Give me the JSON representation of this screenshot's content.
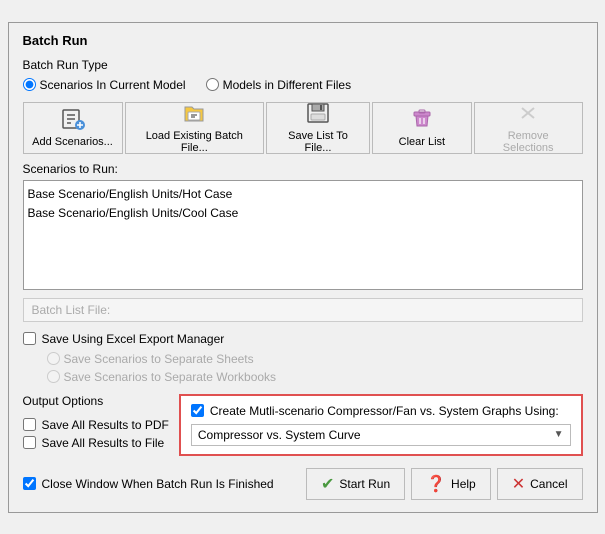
{
  "dialog": {
    "title": "Batch Run",
    "batch_run_type_label": "Batch Run Type",
    "radio_options": [
      {
        "label": "Scenarios In Current Model",
        "value": "scenarios",
        "checked": true
      },
      {
        "label": "Models in Different Files",
        "value": "models",
        "checked": false
      }
    ],
    "toolbar": {
      "buttons": [
        {
          "label": "Add Scenarios...",
          "icon": "📋",
          "disabled": false,
          "name": "add-scenarios-button"
        },
        {
          "label": "Load Existing Batch File...",
          "icon": "📂",
          "disabled": false,
          "name": "load-batch-button"
        },
        {
          "label": "Save List To File...",
          "icon": "💾",
          "disabled": false,
          "name": "save-list-button"
        },
        {
          "label": "Clear List",
          "icon": "🗑",
          "disabled": false,
          "name": "clear-list-button"
        },
        {
          "label": "Remove Selections",
          "icon": "✕",
          "disabled": true,
          "name": "remove-selections-button"
        }
      ]
    },
    "scenarios_label": "Scenarios to Run:",
    "scenarios": [
      "Base Scenario/English Units/Hot Case",
      "Base Scenario/English Units/Cool Case"
    ],
    "batch_list_file_label": "Batch List File:",
    "save_excel_label": "Save Using Excel Export Manager",
    "save_excel_checked": false,
    "radio_sheets_label": "Save Scenarios to Separate Sheets",
    "radio_workbooks_label": "Save Scenarios to Separate Workbooks",
    "output_options_label": "Output Options",
    "save_pdf_label": "Save All Results to PDF",
    "save_pdf_checked": false,
    "save_file_label": "Save All Results to File",
    "save_file_checked": false,
    "create_multi_label": "Create Mutli-scenario Compressor/Fan vs. System Graphs Using:",
    "create_multi_checked": true,
    "dropdown_value": "Compressor vs. System Curve",
    "dropdown_options": [
      "Compressor vs. System Curve"
    ],
    "close_window_label": "Close Window When Batch Run Is Finished",
    "close_window_checked": true,
    "buttons": {
      "start_run": "Start Run",
      "help": "Help",
      "cancel": "Cancel"
    }
  }
}
